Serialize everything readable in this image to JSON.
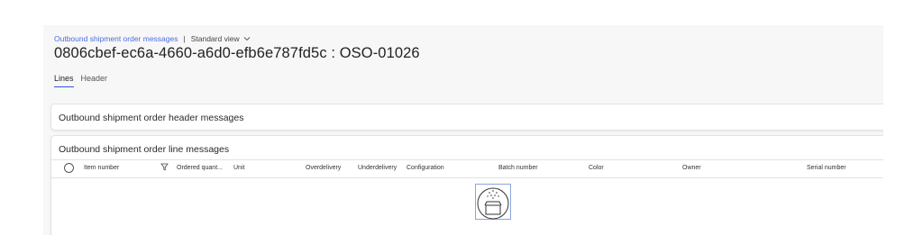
{
  "breadcrumb": {
    "link": "Outbound shipment order messages",
    "separator": "|",
    "view": "Standard view"
  },
  "page_title": "0806cbef-ec6a-4660-a6d0-efb6e787fd5c : OSO-01026",
  "tabs": [
    {
      "label": "Lines",
      "active": true
    },
    {
      "label": "Header",
      "active": false
    }
  ],
  "sections": {
    "header_messages": {
      "title": "Outbound shipment order header messages"
    },
    "line_messages": {
      "title": "Outbound shipment order line messages"
    }
  },
  "grid": {
    "columns": [
      "Item number",
      "Ordered quant...",
      "Unit",
      "Overdelivery",
      "Underdelivery",
      "Configuration",
      "Batch number",
      "Color",
      "Owner",
      "Serial number"
    ]
  },
  "colors": {
    "link": "#4a6ee0",
    "active_tab_underline": "#2d5bd6",
    "page_background": "#f7f7f7"
  },
  "icons": {
    "view_chevron": "chevron-down-icon",
    "filter": "filter-icon",
    "empty_state": "empty-box-icon"
  }
}
